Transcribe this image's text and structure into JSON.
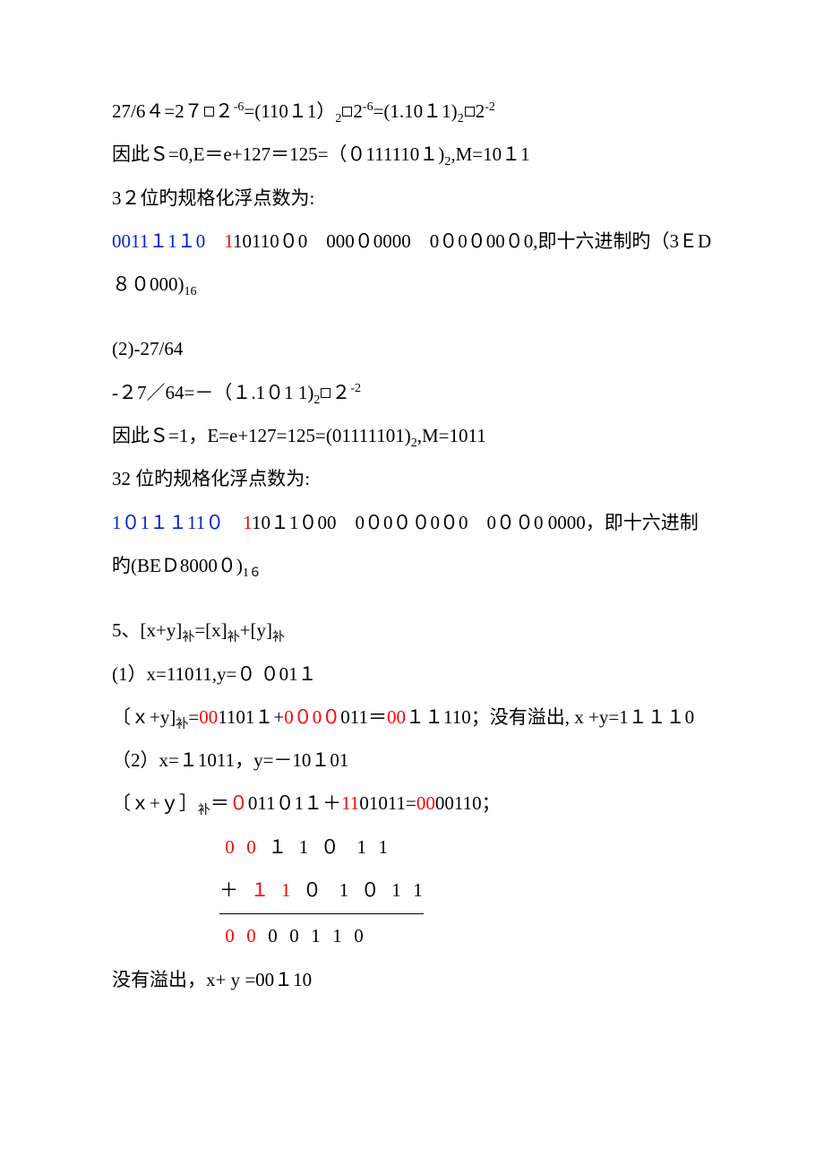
{
  "lines": {
    "l1": "27/6４=2７□２⁻⁶=(110１1）₂□2⁻⁶=(1.10１1)₂□2⁻²",
    "l2": "因此Ｓ=0,E＝e+127＝125=（０111110１)₂,M=10１1",
    "l3": "3２位旳规格化浮点数为:",
    "l4a_blue": "0011１1１0",
    "l4b_red": "1",
    "l4c": "10110０0　000０0000　0０0０00０0,即十六进制旳（3ＥD８０000)₁₆",
    "l5": "(2)-27/64",
    "l6": "-２7／64=－（１.1０1 1)₂□２⁻²",
    "l7": "因此Ｓ=1，E=e+127=125=(01111101)₂,M=1011",
    "l8": "32 位旳规格化浮点数为:",
    "l9a_blue": "1０1１１11０",
    "l9b_red": "1",
    "l9c": "10１1０00　0０0００0０0　0００0 0000，即十六进制旳(BEＤ8000０)₁₆",
    "l10": "5、[x+y]补=[x]补+[y]补",
    "l11": "(1）x=11011,y=０ ０01１",
    "l12p": "〔ｘ+y]补=",
    "l12a": "00",
    "l12b": "1101１+",
    "l12c": "0０0０",
    "l12d": "011＝",
    "l12e": "00",
    "l12f": "１１110；没有溢出, x +y=1１１１0",
    "l13": "（2）x=１1011，y=－10１01",
    "l14p": "〔ｘ+ｙ］补＝",
    "l14a": "０",
    "l14b": "011０1１＋",
    "l14c": "11",
    "l14d": "01011=",
    "l14e": "00",
    "l14f": "00110；",
    "calc_r1": "0  0  １  1  ０   1  1",
    "calc_plus": "＋",
    "calc_r2": "１  1  ０   1  ０  1  1",
    "calc_r3": "0  0  0  0  1  1  0",
    "l15": "没有溢出，x+ y =00１10"
  }
}
